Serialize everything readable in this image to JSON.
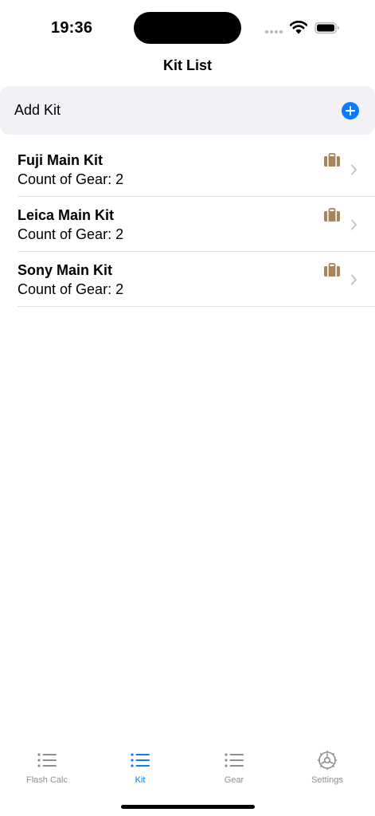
{
  "status_bar": {
    "time": "19:36",
    "icons": [
      "cellular-signal-icon",
      "wifi-icon",
      "battery-icon"
    ]
  },
  "nav": {
    "title": "Kit List"
  },
  "add_kit": {
    "label": "Add Kit",
    "icon": "plus-circle-icon",
    "accent_color": "#0A7AFF"
  },
  "kits": [
    {
      "name": "Fuji Main Kit",
      "count": "Count of Gear: 2",
      "icon": "briefcase-icon"
    },
    {
      "name": "Leica Main Kit",
      "count": "Count of Gear: 2",
      "icon": "briefcase-icon"
    },
    {
      "name": "Sony Main Kit",
      "count": "Count of Gear: 2",
      "icon": "briefcase-icon"
    }
  ],
  "colors": {
    "briefcase": "#A8845A",
    "chevron": "#C4C4C7",
    "tab_inactive": "#8E8E93",
    "tab_active": "#0A7AFF"
  },
  "tab_bar": {
    "tabs": [
      {
        "label": "Flash Calc",
        "icon": "list-icon",
        "active": false
      },
      {
        "label": "Kit",
        "icon": "list-icon",
        "active": true
      },
      {
        "label": "Gear",
        "icon": "list-icon",
        "active": false
      },
      {
        "label": "Settings",
        "icon": "gear-icon",
        "active": false
      }
    ]
  }
}
